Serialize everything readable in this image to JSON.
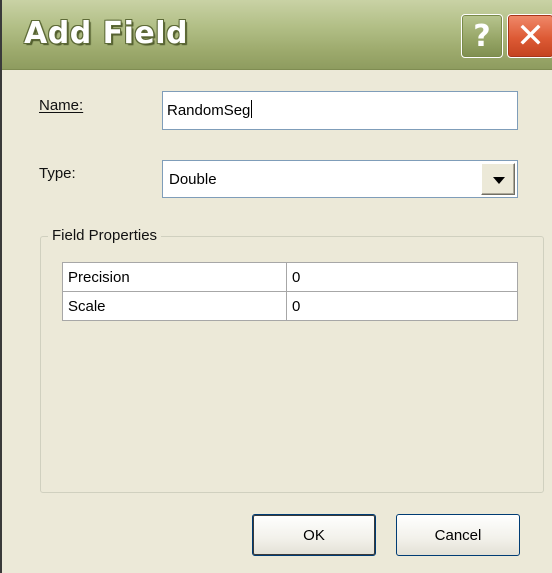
{
  "window": {
    "title": "Add Field"
  },
  "titlebar": {
    "help_glyph": "?",
    "close_glyph": "✕"
  },
  "form": {
    "name_label": "Name:",
    "name_value": "RandomSeg",
    "type_label": "Type:",
    "type_value": "Double"
  },
  "field_properties": {
    "title": "Field Properties",
    "rows": [
      {
        "key": "Precision",
        "value": "0"
      },
      {
        "key": "Scale",
        "value": "0"
      }
    ]
  },
  "buttons": {
    "ok": "OK",
    "cancel": "Cancel"
  },
  "colors": {
    "titlebar": "#9ca96c",
    "close_button": "#dd5a35",
    "dialog_background": "#ece9d8"
  }
}
